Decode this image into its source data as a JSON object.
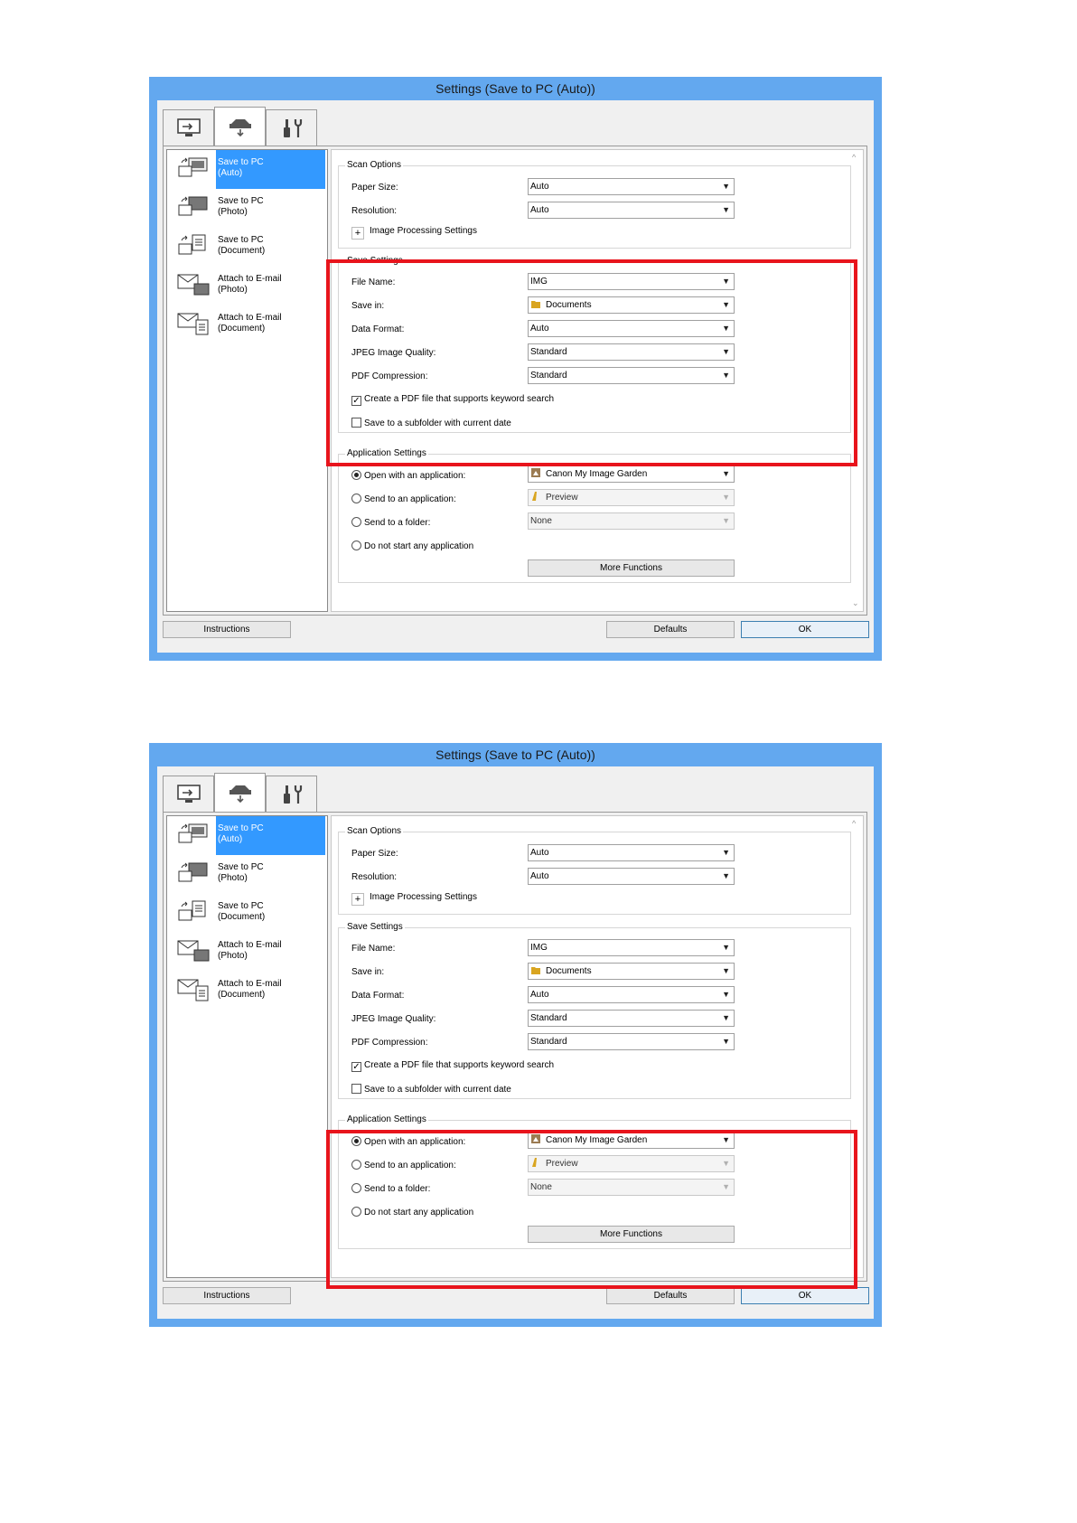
{
  "window": {
    "title": "Settings (Save to PC (Auto))"
  },
  "tabs": [
    {
      "icon": "computer-scan-icon"
    },
    {
      "icon": "scanner-icon"
    },
    {
      "icon": "tools-icon"
    }
  ],
  "sidebar": {
    "items": [
      {
        "label": "Save to PC\n(Auto)",
        "icon": "save-auto-icon"
      },
      {
        "label": "Save to PC\n(Photo)",
        "icon": "save-photo-icon"
      },
      {
        "label": "Save to PC\n(Document)",
        "icon": "save-document-icon"
      },
      {
        "label": "Attach to E-mail\n(Photo)",
        "icon": "mail-photo-icon"
      },
      {
        "label": "Attach to E-mail\n(Document)",
        "icon": "mail-document-icon"
      }
    ]
  },
  "scan_options": {
    "title": "Scan Options",
    "paper_size_label": "Paper Size:",
    "paper_size_value": "Auto",
    "resolution_label": "Resolution:",
    "resolution_value": "Auto",
    "image_processing_label": "Image Processing Settings"
  },
  "save_settings": {
    "title": "Save Settings",
    "file_name_label": "File Name:",
    "file_name_value": "IMG",
    "save_in_label": "Save in:",
    "save_in_value": "Documents",
    "data_format_label": "Data Format:",
    "data_format_value": "Auto",
    "jpeg_quality_label": "JPEG Image Quality:",
    "jpeg_quality_value": "Standard",
    "pdf_compression_label": "PDF Compression:",
    "pdf_compression_value": "Standard",
    "keyword_search_label": "Create a PDF file that supports keyword search",
    "keyword_search_checked": true,
    "subfolder_label": "Save to a subfolder with current date",
    "subfolder_checked": false
  },
  "application_settings": {
    "title": "Application Settings",
    "open_with_label": "Open with an application:",
    "open_with_value": "Canon My Image Garden",
    "send_to_app_label": "Send to an application:",
    "send_to_app_value": "Preview",
    "send_to_folder_label": "Send to a folder:",
    "send_to_folder_value": "None",
    "do_not_start_label": "Do not start any application",
    "more_functions_label": "More Functions"
  },
  "buttons": {
    "instructions": "Instructions",
    "defaults": "Defaults",
    "ok": "OK"
  },
  "highlight_color": "#e8141c",
  "accent_color": "#3399ff"
}
